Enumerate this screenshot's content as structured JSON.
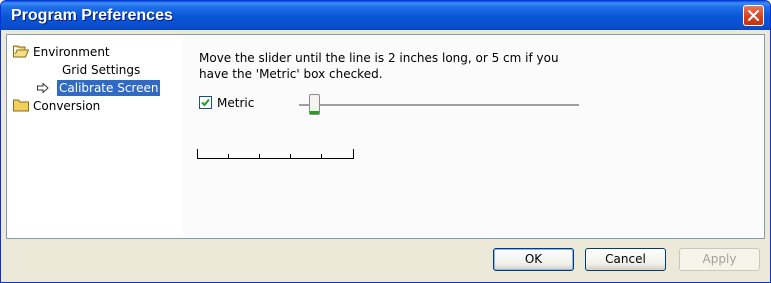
{
  "window": {
    "title": "Program Preferences"
  },
  "tree": {
    "items": [
      {
        "label": "Environment"
      },
      {
        "label": "Grid Settings"
      },
      {
        "label": "Calibrate Screen"
      },
      {
        "label": "Conversion"
      }
    ]
  },
  "calibrate": {
    "instruction": "Move the slider until the line is 2 inches long, or 5 cm if you have the 'Metric' box checked.",
    "metric_label": "Metric",
    "metric_checked": true
  },
  "buttons": {
    "ok": "OK",
    "cancel": "Cancel",
    "apply": "Apply"
  },
  "colors": {
    "title_bar": "#0a54d6",
    "selection": "#316ac5",
    "close": "#d6431f",
    "checkmark": "#21a121"
  }
}
